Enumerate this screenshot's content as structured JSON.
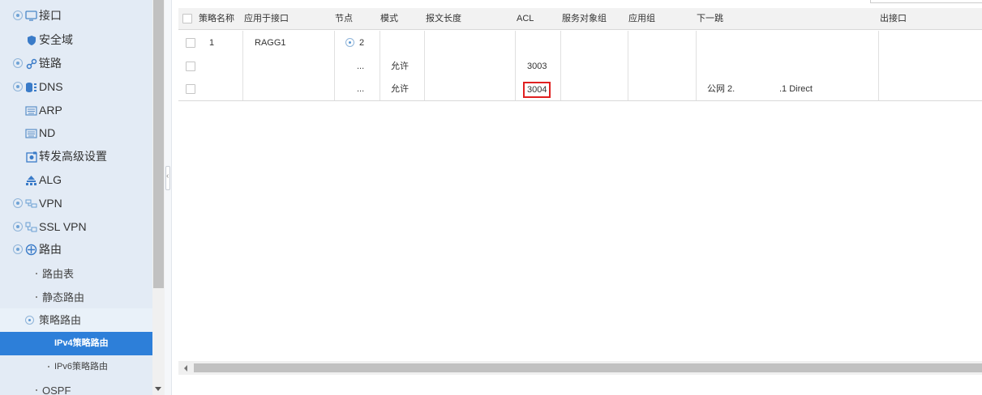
{
  "sidebar": {
    "items": [
      {
        "label": "接口",
        "icon": "monitor-icon",
        "expandable": true
      },
      {
        "label": "安全域",
        "icon": "shield-icon",
        "expandable": false
      },
      {
        "label": "链路",
        "icon": "link-icon",
        "expandable": true
      },
      {
        "label": "DNS",
        "icon": "database-icon",
        "expandable": true
      },
      {
        "label": "ARP",
        "icon": "keyboard-icon",
        "expandable": false
      },
      {
        "label": "ND",
        "icon": "keyboard-icon",
        "expandable": false
      },
      {
        "label": "转发高级设置",
        "icon": "settings-box-icon",
        "expandable": false
      },
      {
        "label": "ALG",
        "icon": "network-tree-icon",
        "expandable": false
      },
      {
        "label": "VPN",
        "icon": "vpn-icon",
        "expandable": true
      },
      {
        "label": "SSL VPN",
        "icon": "ssl-vpn-icon",
        "expandable": true
      },
      {
        "label": "路由",
        "icon": "route-icon",
        "expandable": true
      }
    ],
    "routing_children": [
      "路由表",
      "静态路由"
    ],
    "policy_route": "策略路由",
    "policy_children": [
      "IPv4策略路由",
      "IPv6策略路由"
    ],
    "selected": "IPv4策略路由",
    "last_item": "OSPF"
  },
  "table": {
    "headers": [
      "策略名称",
      "应用于接口",
      "节点",
      "模式",
      "报文长度",
      "ACL",
      "服务对象组",
      "应用组",
      "下一跳",
      "出接口"
    ],
    "rows": [
      {
        "name": "1",
        "interface": "RAGG1",
        "node": "2",
        "mode": "",
        "acl": "",
        "next_hop": ""
      },
      {
        "name": "",
        "interface": "",
        "node": "...",
        "mode": "允许",
        "acl": "3003",
        "next_hop": ""
      },
      {
        "name": "",
        "interface": "",
        "node": "...",
        "mode": "允许",
        "acl": "3004",
        "next_hop_a": "公网 2.",
        "next_hop_b": ".1 Direct"
      }
    ],
    "highlighted_acl": "3004"
  },
  "colors": {
    "sidebar_bg": "#e3ebf5",
    "selected_bg": "#2d7fd9",
    "highlight_border": "#e02020"
  }
}
